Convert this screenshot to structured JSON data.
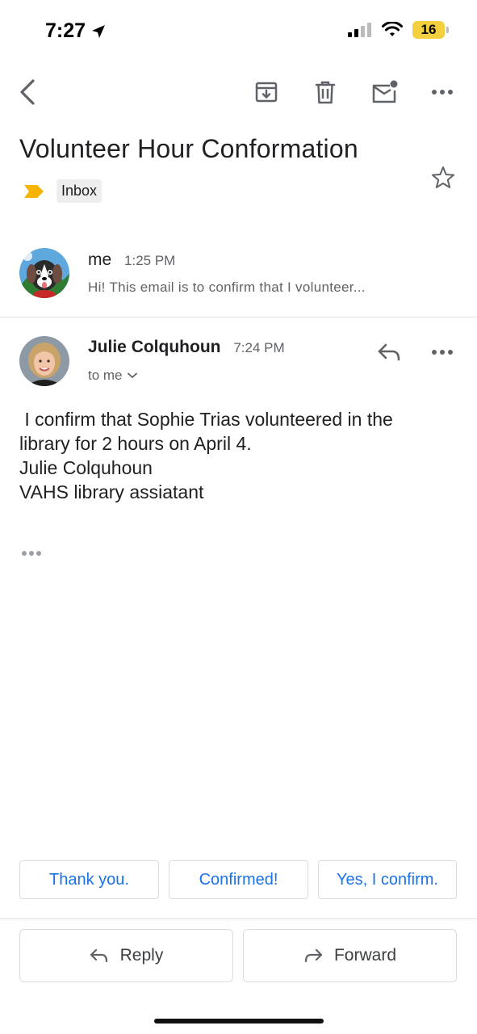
{
  "status_bar": {
    "time": "7:27",
    "battery": "16"
  },
  "email": {
    "subject": "Volunteer Hour Conformation",
    "label": "Inbox",
    "messages_collapsed": [
      {
        "sender": "me",
        "time": "1:25 PM",
        "snippet": "Hi! This email is to confirm that I volunteer..."
      }
    ],
    "message_expanded": {
      "sender": "Julie Colquhoun",
      "time": "7:24 PM",
      "recipient": "to me",
      "body_lines": [
        " I confirm that Sophie Trias volunteered in the",
        "library for 2 hours on April 4.",
        "Julie Colquhoun",
        "VAHS library assiatant"
      ]
    }
  },
  "smart_replies": [
    "Thank you.",
    "Confirmed!",
    "Yes, I confirm."
  ],
  "actions": {
    "reply": "Reply",
    "forward": "Forward"
  },
  "colors": {
    "accent": "#1a73e8",
    "label_marker": "#f6b400",
    "battery": "#f4d03f"
  },
  "icons": [
    "back-arrow-icon",
    "archive-icon",
    "trash-icon",
    "mark-unread-icon",
    "more-icon",
    "star-icon",
    "reply-icon",
    "forward-icon"
  ]
}
